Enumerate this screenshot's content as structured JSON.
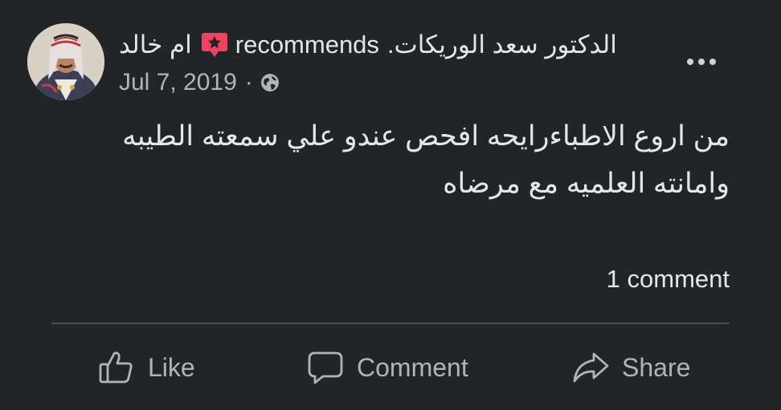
{
  "post": {
    "author": "ام خالد",
    "verb": "recommends",
    "page": "الدكتور سعد الوريكات.",
    "date": "Jul 7, 2019",
    "separator": "·",
    "privacy_icon": "globe-icon",
    "recommend_icon": "star-speech-bubble-icon",
    "badge_color": "#f3425f",
    "body_lines": [
      "من اروع الاطباءرايحه افحص عندو علي سمعته الطيبه",
      "وامانته العلميه مع مرضاه"
    ],
    "comments_count": "1 comment"
  },
  "actions": {
    "like": "Like",
    "comment": "Comment",
    "share": "Share"
  }
}
